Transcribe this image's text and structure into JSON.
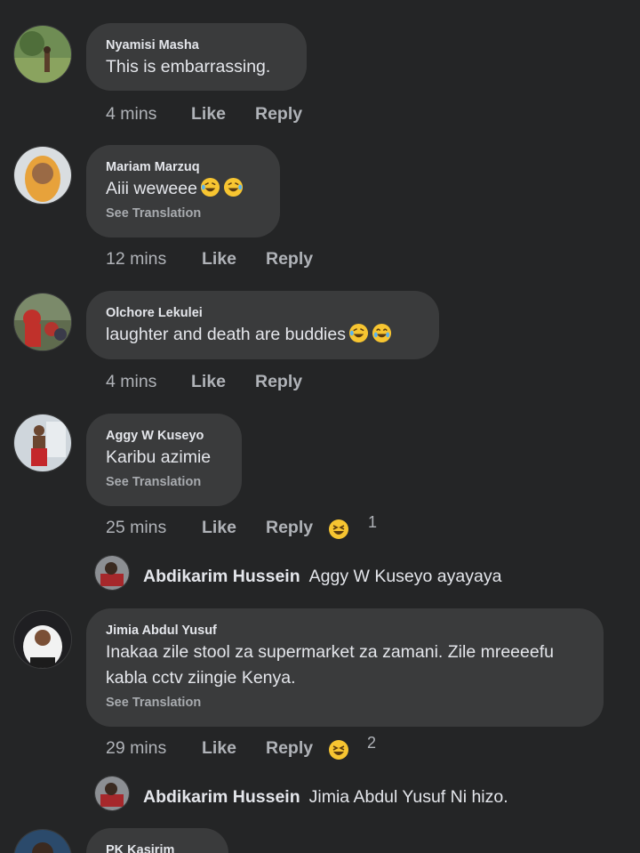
{
  "comments": [
    {
      "name": "Nyamisi Masha",
      "text": "This is embarrassing.",
      "time": "4 mins",
      "like": "Like",
      "reply": "Reply"
    },
    {
      "name": "Mariam Marzuq",
      "text": "Aiii weweee",
      "see_translation": "See Translation",
      "emojis": [
        "rofl-emoji",
        "rofl-emoji"
      ],
      "time": "12 mins",
      "like": "Like",
      "reply": "Reply"
    },
    {
      "name": "Olchore Lekulei",
      "text": "laughter and death are buddies",
      "emojis": [
        "rofl-emoji",
        "joy-emoji"
      ],
      "time": "4 mins",
      "like": "Like",
      "reply": "Reply"
    },
    {
      "name": "Aggy W Kuseyo",
      "text": "Karibu azimie",
      "see_translation": "See Translation",
      "time": "25 mins",
      "like": "Like",
      "reply": "Reply",
      "reaction_emoji": "laughing-emoji",
      "reaction_count": "1",
      "reply_preview": {
        "name": "Abdikarim Hussein",
        "text": "Aggy W Kuseyo ayayaya"
      }
    },
    {
      "name": "Jimia Abdul Yusuf",
      "text_lines": [
        "Inakaa zile stool za supermarket za zamani. Zile mreeeefu",
        "kabla cctv ziingie Kenya."
      ],
      "see_translation": "See Translation",
      "time": "29 mins",
      "like": "Like",
      "reply": "Reply",
      "reaction_emoji": "laughing-emoji",
      "reaction_count": "2",
      "reply_preview": {
        "name": "Abdikarim Hussein",
        "text": "Jimia Abdul Yusuf Ni hizo."
      }
    },
    {
      "name": "PK Kasirim"
    }
  ],
  "colors": {
    "background": "#242526",
    "bubble": "#3a3b3c",
    "text": "#e4e6eb",
    "meta": "#b0b3b8",
    "emoji_yellow": "#f7c531"
  }
}
